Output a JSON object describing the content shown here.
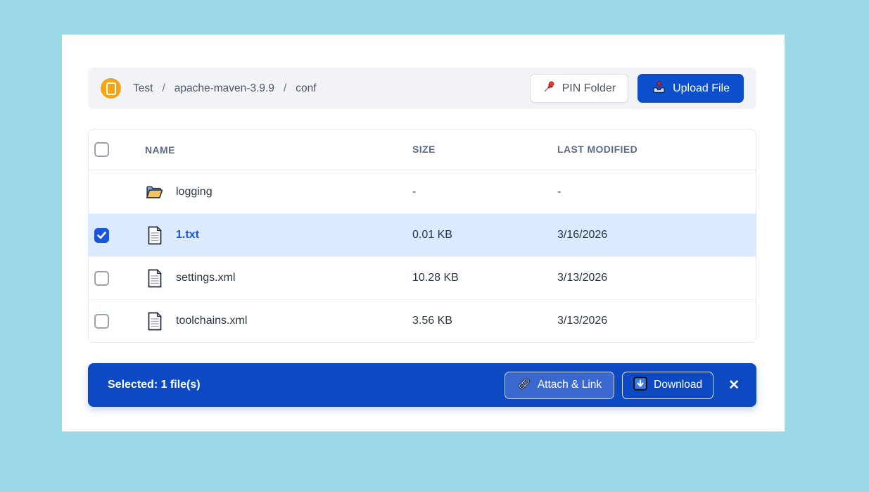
{
  "breadcrumb": {
    "items": [
      "Test",
      "apache-maven-3.9.9",
      "conf"
    ],
    "separator": "/"
  },
  "toolbar": {
    "pin_folder_label": "PIN Folder",
    "upload_file_label": "Upload File"
  },
  "table": {
    "columns": {
      "name": "NAME",
      "size": "SIZE",
      "modified": "LAST MODIFIED"
    },
    "rows": [
      {
        "name": "logging",
        "type": "folder",
        "size": "-",
        "modified": "-",
        "selectable": false,
        "checked": false
      },
      {
        "name": "1.txt",
        "type": "file",
        "size": "0.01 KB",
        "modified": "3/16/2026",
        "selectable": true,
        "checked": true
      },
      {
        "name": "settings.xml",
        "type": "file",
        "size": "10.28 KB",
        "modified": "3/13/2026",
        "selectable": true,
        "checked": false
      },
      {
        "name": "toolchains.xml",
        "type": "file",
        "size": "3.56 KB",
        "modified": "3/13/2026",
        "selectable": true,
        "checked": false
      }
    ]
  },
  "selection_bar": {
    "status": "Selected: 1 file(s)",
    "attach_link_label": "Attach & Link",
    "download_label": "Download",
    "close_glyph": "✕"
  },
  "icons": {
    "breadcrumb_logo": "orange-circle-with-white-square",
    "pin": "red-pushpin",
    "upload": "outbox-tray-red-arrow",
    "folder_row": "open-folder",
    "file_row": "document-page",
    "attach": "chain-link",
    "download": "blue-square-down-arrow",
    "close": "x-mark"
  },
  "colors": {
    "page_bg": "#9cdaea",
    "primary_blue": "#0d4ecd",
    "selection_bar_bg": "#0e49c4",
    "selected_row_bg": "#dbeafe",
    "checkbox_checked": "#1a56db",
    "accent_orange": "#f7a412"
  }
}
